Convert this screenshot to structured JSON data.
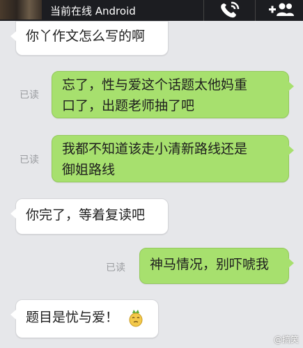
{
  "header": {
    "status_text": "当前在线 Android"
  },
  "messages": [
    {
      "direction": "in",
      "lines": [
        "你丫作文怎么写的啊"
      ]
    },
    {
      "direction": "out",
      "read_label": "已读",
      "lines": [
        "忘了，性与爱这个话题太他妈重",
        "口了，出题老师抽了吧"
      ]
    },
    {
      "direction": "out",
      "read_label": "已读",
      "lines": [
        "我都不知道该走小清新路线还是",
        "御姐路线"
      ]
    },
    {
      "direction": "in",
      "lines": [
        "你完了，等着复读吧"
      ]
    },
    {
      "direction": "out",
      "read_label": "已读",
      "lines": [
        "神马情况，别吓唬我"
      ]
    },
    {
      "direction": "in",
      "lines": [
        "题目是忧与爱！"
      ],
      "emoji": "pineapple-face-emoji"
    }
  ],
  "watermark": "@搞笑",
  "colors": {
    "incoming_bubble": "#ffffff",
    "outgoing_bubble": "#a7e06e",
    "background": "#e6e7ea",
    "topbar": "#1c1d21"
  }
}
